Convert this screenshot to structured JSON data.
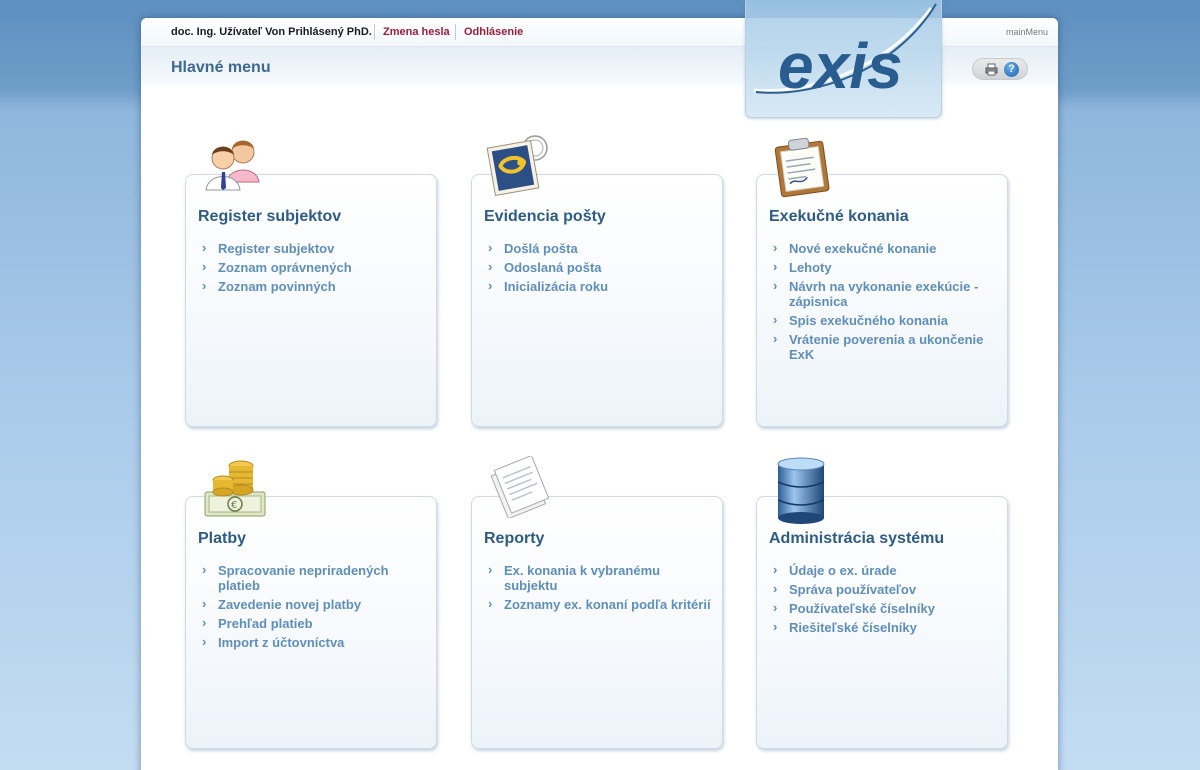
{
  "topbar": {
    "user": "doc. Ing. Užívateľ Von Prihlásený PhD.",
    "change_password": "Zmena hesla",
    "logout": "Odhlásenie",
    "page_id": "mainMenu"
  },
  "header": {
    "title": "Hlavné menu",
    "logo_text": "exis",
    "help_icon_glyph": "?"
  },
  "colors": {
    "accent": "#3e6a8f",
    "link": "#5f8fb8",
    "topbar_link": "#9b1f3c"
  },
  "cards": [
    {
      "title": "Register subjektov",
      "icon": "users-icon",
      "items": [
        "Register subjektov",
        "Zoznam oprávnených",
        "Zoznam povinných"
      ]
    },
    {
      "title": "Evidencia pošty",
      "icon": "postage-stamp-icon",
      "items": [
        "Došlá pošta",
        "Odoslaná pošta",
        "Inicializácia roku"
      ]
    },
    {
      "title": "Exekučné konania",
      "icon": "clipboard-icon",
      "items": [
        "Nové exekučné konanie",
        "Lehoty",
        "Návrh na vykonanie exekúcie - zápisnica",
        "Spis exekučného konania",
        "Vrátenie poverenia a ukončenie ExK"
      ]
    },
    {
      "title": "Platby",
      "icon": "coins-icon",
      "items": [
        "Spracovanie nepriradených platieb",
        "Zavedenie novej platby",
        "Prehľad platieb",
        "Import z účtovníctva"
      ]
    },
    {
      "title": "Reporty",
      "icon": "documents-icon",
      "items": [
        "Ex. konania k vybranému subjektu",
        "Zoznamy ex. konaní podľa kritérií"
      ]
    },
    {
      "title": "Administrácia systému",
      "icon": "database-icon",
      "items": [
        "Údaje o ex. úrade",
        "Správa používateľov",
        "Používateľské číselníky",
        "Riešiteľské číselníky"
      ]
    }
  ]
}
